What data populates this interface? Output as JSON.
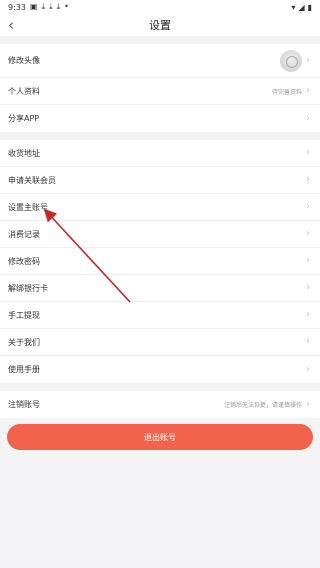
{
  "status": {
    "time": "9:33"
  },
  "header": {
    "title": "设置",
    "back_icon": "back-icon"
  },
  "group1": {
    "items": [
      {
        "label": "修改头像",
        "has_avatar": true
      },
      {
        "label": "个人资料",
        "hint": "待完善资料"
      },
      {
        "label": "分享APP"
      }
    ]
  },
  "group2": {
    "items": [
      {
        "label": "收货地址"
      },
      {
        "label": "申请关联会员"
      },
      {
        "label": "设置主账号"
      },
      {
        "label": "消费记录"
      },
      {
        "label": "修改密码"
      },
      {
        "label": "解绑银行卡"
      },
      {
        "label": "手工提现"
      },
      {
        "label": "关于我们"
      },
      {
        "label": "使用手册"
      }
    ]
  },
  "group3": {
    "items": [
      {
        "label": "注销账号",
        "hint": "注销后无法恢复，请谨慎操作"
      }
    ]
  },
  "logout": {
    "label": "退出账号"
  },
  "colors": {
    "accent": "#f2624c",
    "annotation": "#c62828"
  }
}
